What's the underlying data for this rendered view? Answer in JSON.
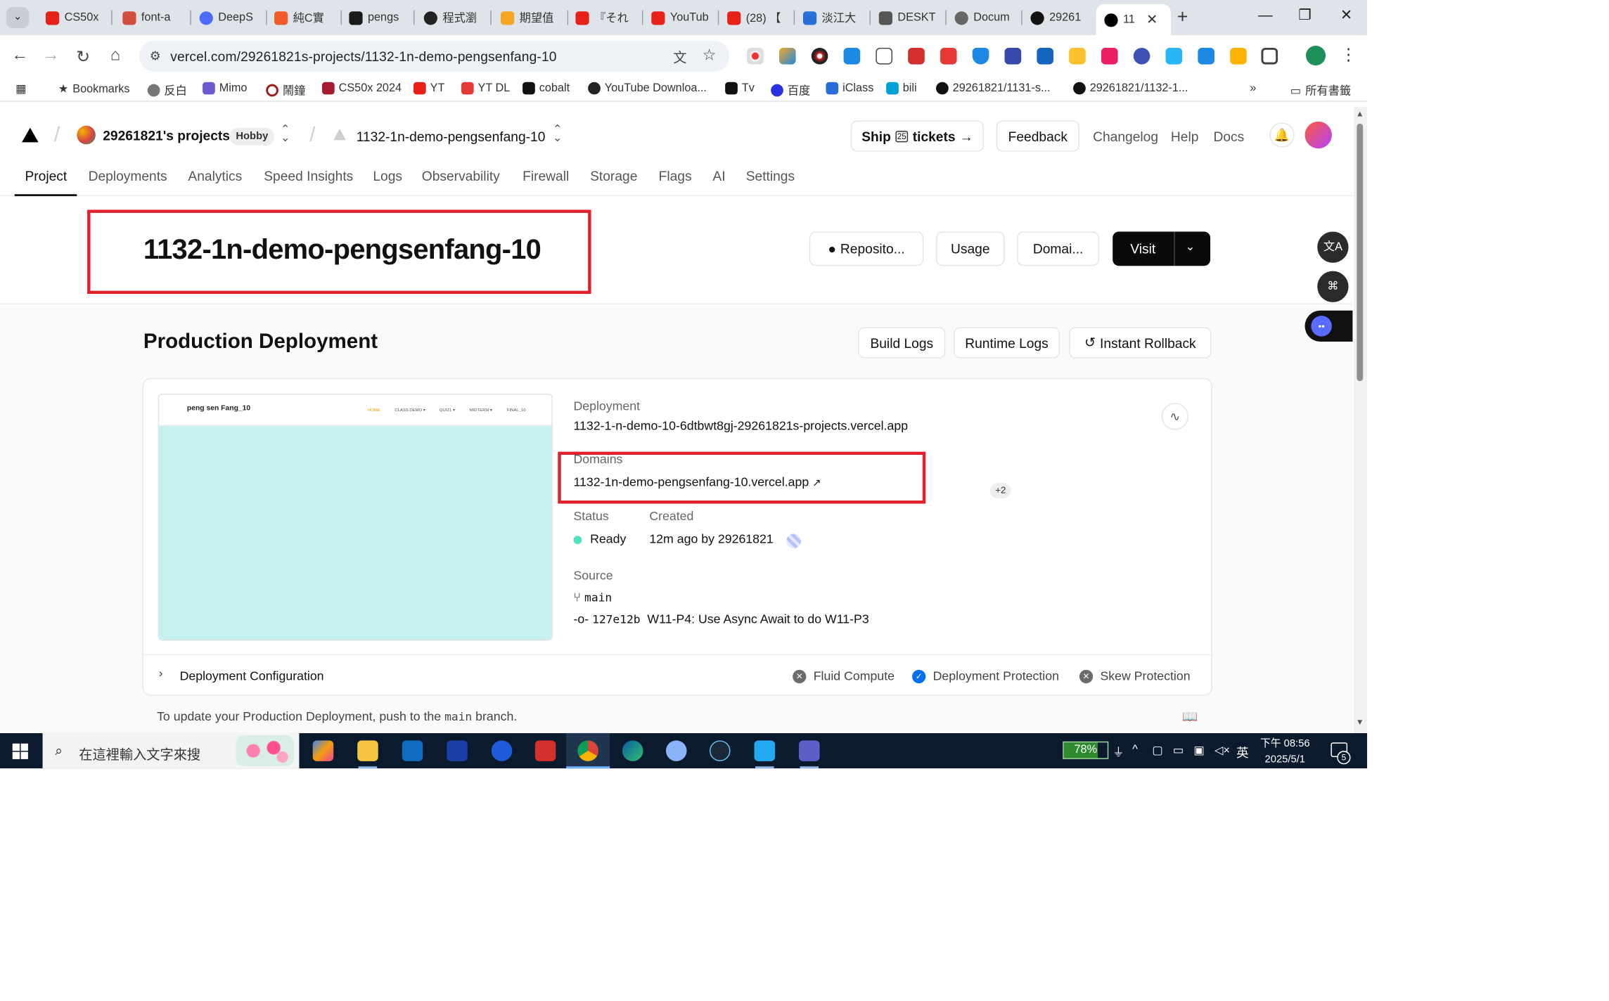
{
  "browser": {
    "tabs": [
      {
        "label": "CS50x",
        "color": "#e62117"
      },
      {
        "label": "font-a",
        "color": "#d14e3c"
      },
      {
        "label": "DeepS",
        "color": "#4d6bfe"
      },
      {
        "label": "純C實",
        "color": "#f25c2a"
      },
      {
        "label": "pengs",
        "color": "#1a1a1a"
      },
      {
        "label": "程式瀏",
        "color": "#222222"
      },
      {
        "label": "期望值",
        "color": "#f5a623"
      },
      {
        "label": "『それ",
        "color": "#e62117"
      },
      {
        "label": "YouTub",
        "color": "#e62117"
      },
      {
        "label": "(28) 【",
        "color": "#e62117"
      },
      {
        "label": "淡江大",
        "color": "#2a6fd6"
      },
      {
        "label": "DESKT",
        "color": "#555555"
      },
      {
        "label": "Docum",
        "color": "#666666"
      },
      {
        "label": "29261",
        "color": "#111111"
      },
      {
        "label": "11",
        "color": "#000000"
      }
    ],
    "url": "vercel.com/29261821s-projects/1132-1n-demo-pengsenfang-10",
    "bookmarks": [
      "Bookmarks",
      "反白",
      "Mimo",
      "鬧鐘",
      "CS50x 2024",
      "YT",
      "YT DL",
      "cobalt",
      "YouTube Downloa...",
      "Tv",
      "百度",
      "iClass",
      "bili",
      "29261821/1131-s...",
      "29261821/1132-1...",
      "所有書籤"
    ]
  },
  "vercel": {
    "team_name": "29261821's projects",
    "plan_badge": "Hobby",
    "project_name": "1132-1n-demo-pengsenfang-10",
    "ship_prefix": "Ship",
    "ship_badge": "25",
    "ship_suffix": "tickets",
    "feedback": "Feedback",
    "changelog": "Changelog",
    "help": "Help",
    "docs": "Docs",
    "nav": [
      "Project",
      "Deployments",
      "Analytics",
      "Speed Insights",
      "Logs",
      "Observability",
      "Firewall",
      "Storage",
      "Flags",
      "AI",
      "Settings"
    ],
    "title": "1132-1n-demo-pengsenfang-10",
    "repo_btn": "Reposito...",
    "usage_btn": "Usage",
    "domains_btn": "Domai...",
    "visit_btn": "Visit",
    "section_title": "Production Deployment",
    "build_logs": "Build Logs",
    "runtime_logs": "Runtime Logs",
    "instant_rollback": "Instant Rollback",
    "preview": {
      "brand": "peng sen Fang_10",
      "links": [
        "HOME",
        "CLASS DEMO ▾",
        "QUIZ1 ▾",
        "MIDTERM ▾",
        "FINAL_10"
      ]
    },
    "deployment_label": "Deployment",
    "deployment_url": "1132-1-n-demo-10-6dtbwt8gj-29261821s-projects.vercel.app",
    "domains_label": "Domains",
    "domain_url": "1132-1n-demo-pengsenfang-10.vercel.app",
    "domains_more": "+2",
    "status_label": "Status",
    "status_value": "Ready",
    "created_label": "Created",
    "created_value": "12m ago by 29261821",
    "source_label": "Source",
    "branch": "main",
    "commit_hash": "127e12b",
    "commit_msg": "W11-P4: Use Async Await to do W11-P3",
    "config_label": "Deployment Configuration",
    "fluid_compute": "Fluid Compute",
    "deployment_protection": "Deployment Protection",
    "skew_protection": "Skew Protection",
    "footer_prefix": "To update your Production Deployment, push to the",
    "footer_branch": "main",
    "footer_suffix": "branch."
  },
  "taskbar": {
    "search_placeholder": "在這裡輸入文字來搜",
    "battery": "78%",
    "ime": "英",
    "time": "下午 08:56",
    "date": "2025/5/1",
    "notifications": "5"
  }
}
